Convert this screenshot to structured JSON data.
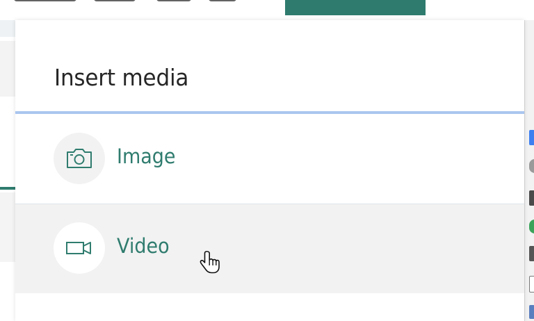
{
  "dialog": {
    "title": "Insert media",
    "items": [
      {
        "label": "Image",
        "icon": "camera-icon"
      },
      {
        "label": "Video",
        "icon": "video-camera-icon"
      }
    ]
  },
  "colors": {
    "accent": "#2f7c6e",
    "title_text": "#262626",
    "header_rule": "#a9c6ef",
    "hover_row": "#f2f2f2",
    "icon_circle": "#f2f2f2"
  },
  "cursor": {
    "type": "hand-pointer",
    "hovering": "Video"
  }
}
